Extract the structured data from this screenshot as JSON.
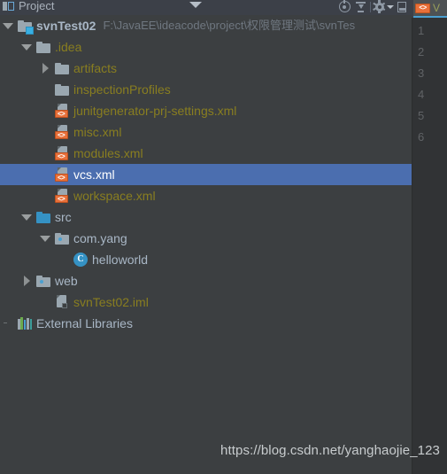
{
  "toolwindow": {
    "title": "Project",
    "icon": "project-window-icon",
    "view_chevron": "chevron-down-icon",
    "actions": [
      {
        "name": "locate-icon",
        "tooltip": "Select Opened File"
      },
      {
        "name": "collapse-all-icon",
        "tooltip": "Collapse All"
      },
      {
        "name": "gear-icon",
        "tooltip": "Settings"
      },
      {
        "name": "hide-window-icon",
        "tooltip": "Hide"
      }
    ]
  },
  "editor": {
    "tab": {
      "label": "V",
      "icon": "xml-file-icon",
      "badge_text": "<>"
    },
    "line_numbers": [
      "1",
      "2",
      "3",
      "4",
      "5",
      "6"
    ]
  },
  "colors": {
    "background": "#3c3f41",
    "header_background": "#3c4048",
    "selection": "#4b6eaf",
    "gutter_background": "#313335",
    "text_default": "#a9b7c6",
    "text_excluded": "#897e20",
    "text_selected": "#ffffff",
    "accent_orange": "#e8703a",
    "accent_blue": "#3592c4",
    "tab_underline": "#4a9fd0"
  },
  "tree": {
    "rows": [
      {
        "id": "svnTest02",
        "label": "svnTest02",
        "secondary": "F:\\JavaEE\\ideacode\\project\\权限管理测试\\svnTes",
        "indent": 0,
        "handle": "expanded",
        "icon": "module-folder-icon",
        "style": "bold",
        "selected": false
      },
      {
        "id": "idea",
        "label": ".idea",
        "secondary": "",
        "indent": 1,
        "handle": "expanded",
        "icon": "folder-icon",
        "style": "excluded",
        "selected": false
      },
      {
        "id": "artifacts",
        "label": "artifacts",
        "secondary": "",
        "indent": 2,
        "handle": "collapsed",
        "icon": "folder-icon",
        "style": "excluded",
        "selected": false
      },
      {
        "id": "inspectionProfiles",
        "label": "inspectionProfiles",
        "secondary": "",
        "indent": 2,
        "handle": "none",
        "icon": "folder-icon",
        "style": "excluded",
        "selected": false
      },
      {
        "id": "junitgenerator-prj-settings.xml",
        "label": "junitgenerator-prj-settings.xml",
        "secondary": "",
        "indent": 2,
        "handle": "none",
        "icon": "xml-file-icon",
        "style": "excluded",
        "selected": false
      },
      {
        "id": "misc.xml",
        "label": "misc.xml",
        "secondary": "",
        "indent": 2,
        "handle": "none",
        "icon": "xml-file-icon",
        "style": "excluded",
        "selected": false
      },
      {
        "id": "modules.xml",
        "label": "modules.xml",
        "secondary": "",
        "indent": 2,
        "handle": "none",
        "icon": "xml-file-icon",
        "style": "excluded",
        "selected": false
      },
      {
        "id": "vcs.xml",
        "label": "vcs.xml",
        "secondary": "",
        "indent": 2,
        "handle": "none",
        "icon": "xml-file-icon",
        "style": "selected",
        "selected": true
      },
      {
        "id": "workspace.xml",
        "label": "workspace.xml",
        "secondary": "",
        "indent": 2,
        "handle": "none",
        "icon": "xml-file-icon",
        "style": "excluded",
        "selected": false
      },
      {
        "id": "src",
        "label": "src",
        "secondary": "",
        "indent": 1,
        "handle": "expanded",
        "icon": "source-folder-icon",
        "style": "plain",
        "selected": false
      },
      {
        "id": "com.yang",
        "label": "com.yang",
        "secondary": "",
        "indent": 2,
        "handle": "expanded",
        "icon": "package-folder-icon",
        "style": "plain",
        "selected": false
      },
      {
        "id": "helloworld",
        "label": "helloworld",
        "secondary": "",
        "indent": 3,
        "handle": "none",
        "icon": "class-icon",
        "style": "plain",
        "selected": false
      },
      {
        "id": "web",
        "label": "web",
        "secondary": "",
        "indent": 1,
        "handle": "collapsed",
        "icon": "package-folder-icon",
        "style": "plain",
        "selected": false
      },
      {
        "id": "svnTest02.iml",
        "label": "svnTest02.iml",
        "secondary": "",
        "indent": 2,
        "handle": "none",
        "icon": "iml-file-icon",
        "style": "excluded",
        "selected": false
      },
      {
        "id": "External Libraries",
        "label": "External Libraries",
        "secondary": "",
        "indent": 0,
        "handle": "none",
        "icon": "libraries-icon",
        "style": "plain",
        "selected": false
      }
    ]
  },
  "watermark": {
    "text": "https://blog.csdn.net/yanghaojie_123"
  }
}
